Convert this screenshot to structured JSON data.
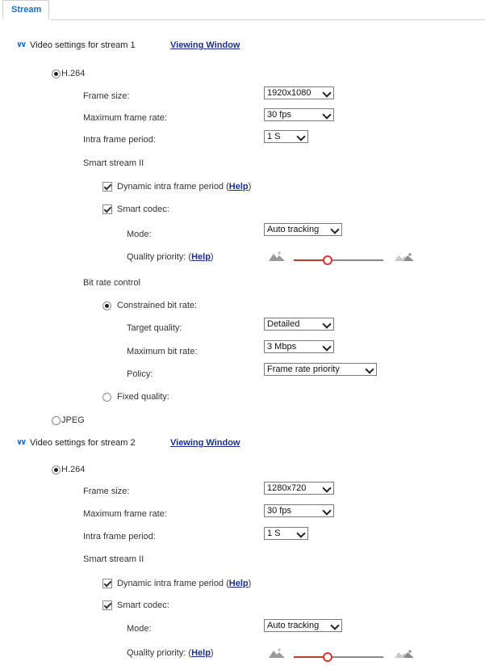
{
  "tabs": [
    {
      "label": "Stream"
    }
  ],
  "streams": [
    {
      "section_title": "Video settings for stream 1",
      "viewing_window": "Viewing Window",
      "codec_h264": "H.264",
      "frame_size_label": "Frame size:",
      "frame_size_value": "1920x1080",
      "max_frame_rate_label": "Maximum frame rate:",
      "max_frame_rate_value": "30 fps",
      "intra_period_label": "Intra frame period:",
      "intra_period_value": "1 S",
      "smart_stream_label": "Smart stream II",
      "dynamic_intra_label": "Dynamic intra frame period (",
      "help_label": "Help",
      "close_paren": ")",
      "smart_codec_label": "Smart codec:",
      "mode_label": "Mode:",
      "mode_value": "Auto tracking",
      "quality_priority_label": "Quality priority: (",
      "bitrate_control_label": "Bit rate control",
      "constrained_label": "Constrained bit rate:",
      "target_quality_label": "Target quality:",
      "target_quality_value": "Detailed",
      "max_bitrate_label": "Maximum bit rate:",
      "max_bitrate_value": "3 Mbps",
      "policy_label": "Policy:",
      "policy_value": "Frame rate priority",
      "fixed_quality_label": "Fixed quality:",
      "codec_jpeg": "JPEG",
      "quality_priority_level": 0.38
    },
    {
      "section_title": "Video settings for stream 2",
      "viewing_window": "Viewing Window",
      "codec_h264": "H.264",
      "frame_size_label": "Frame size:",
      "frame_size_value": "1280x720",
      "max_frame_rate_label": "Maximum frame rate:",
      "max_frame_rate_value": "30 fps",
      "intra_period_label": "Intra frame period:",
      "intra_period_value": "1 S",
      "smart_stream_label": "Smart stream II",
      "dynamic_intra_label": "Dynamic intra frame period (",
      "help_label": "Help",
      "close_paren": ")",
      "smart_codec_label": "Smart codec:",
      "mode_label": "Mode:",
      "mode_value": "Auto tracking",
      "quality_priority_label": "Quality priority: (",
      "quality_priority_level": 0.38
    }
  ],
  "icons": {
    "chevron": "chevron-double-down-icon",
    "quality_low": "landscape-low-icon",
    "quality_high": "landscape-high-icon"
  },
  "colors": {
    "link": "#1a2f8f",
    "tab_text": "#1a6ec4",
    "slider_thumb": "#dd3333"
  }
}
